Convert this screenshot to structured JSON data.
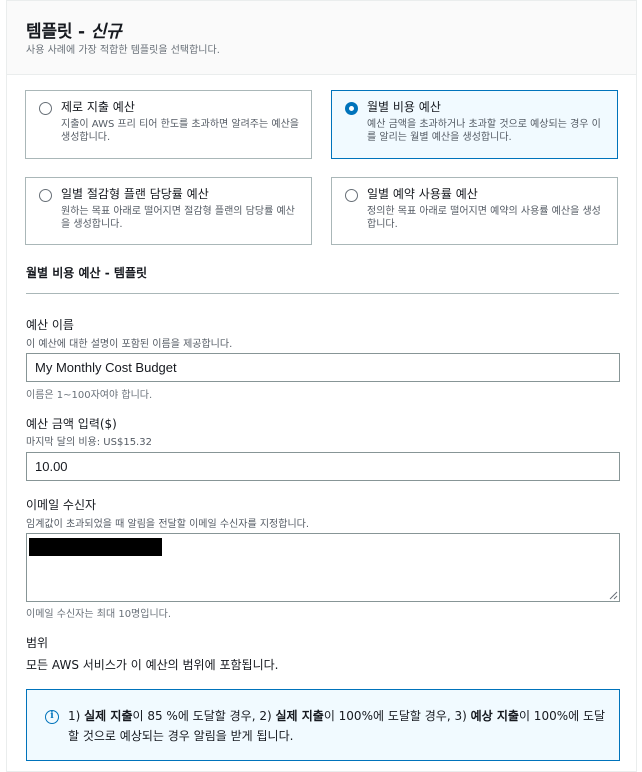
{
  "header": {
    "title": "템플릿 - ",
    "title_emphasis": "신규",
    "subtitle": "사용 사례에 가장 적합한 템플릿을 선택합니다."
  },
  "templates": [
    {
      "title": "제로 지출 예산",
      "desc": "지출이 AWS 프리 티어 한도를 초과하면 알려주는 예산을 생성합니다.",
      "selected": false
    },
    {
      "title": "월별 비용 예산",
      "desc": "예산 금액을 초과하거나 초과할 것으로 예상되는 경우 이를 알리는 월별 예산을 생성합니다.",
      "selected": true
    },
    {
      "title": "일별 절감형 플랜 담당률 예산",
      "desc": "원하는 목표 아래로 떨어지면 절감형 플랜의 담당률 예산을 생성합니다.",
      "selected": false
    },
    {
      "title": "일별 예약 사용률 예산",
      "desc": "정의한 목표 아래로 떨어지면 예약의 사용률 예산을 생성합니다.",
      "selected": false
    }
  ],
  "section": {
    "title": "월별 비용 예산 - 템플릿"
  },
  "budget_name": {
    "label": "예산 이름",
    "desc": "이 예산에 대한 설명이 포함된 이름을 제공합니다.",
    "value": "My Monthly Cost Budget",
    "hint": "이름은 1~100자여야 합니다."
  },
  "budget_amount": {
    "label": "예산 금액 입력($)",
    "desc": "마지막 달의 비용: US$15.32",
    "value": "10.00"
  },
  "email": {
    "label": "이메일 수신자",
    "desc": "임계값이 초과되었을 때 알림을 전달할 이메일 수신자를 지정합니다.",
    "hint": "이메일 수신자는 최대 10명입니다."
  },
  "scope": {
    "label": "범위",
    "text": "모든 AWS 서비스가 이 예산의 범위에 포함됩니다."
  },
  "alert": {
    "icon": "info-icon",
    "p1": "1) ",
    "b1": "실제 지출",
    "p2": "이 85 %에 도달할 경우, 2) ",
    "b2": "실제 지출",
    "p3": "이 100%에 도달할 경우, 3) ",
    "b3": "예상 지출",
    "p4": "이 100%에 도달할 것으로 예상되는 경우 알림을 받게 됩니다."
  },
  "colors": {
    "accent": "#0073bb",
    "selected_bg": "#f1faff",
    "border": "#aab7b8"
  }
}
